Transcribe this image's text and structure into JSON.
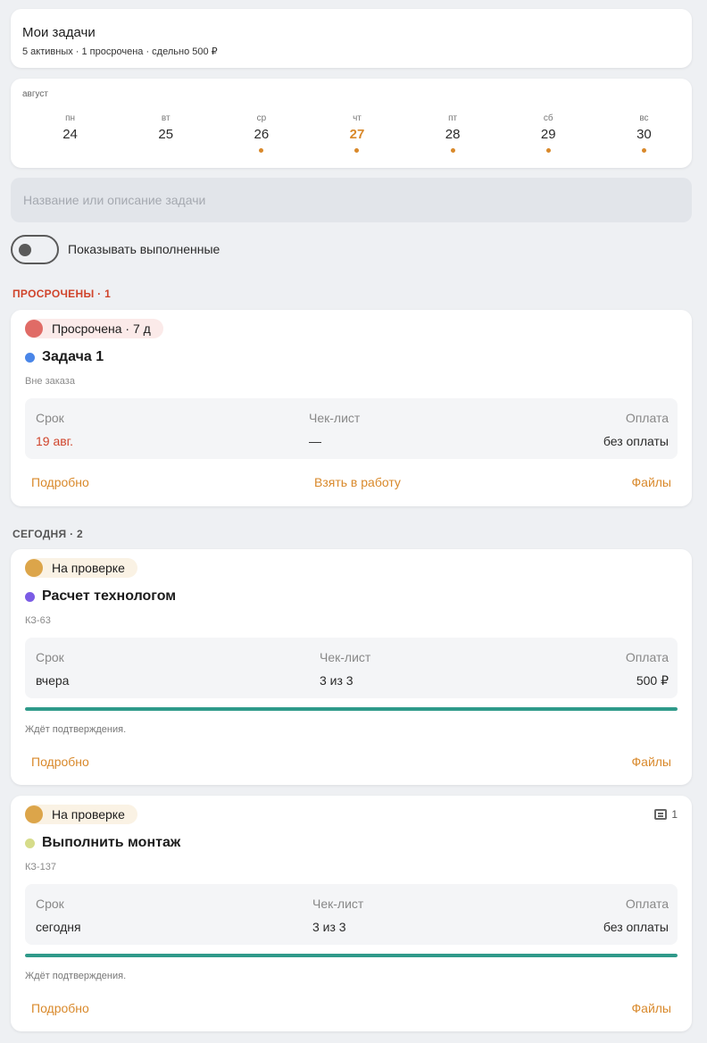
{
  "header": {
    "title": "Мои задачи",
    "subtitle": "5 активных · 1 просрочена · сдельно 500 ₽"
  },
  "calendar": {
    "month": "август",
    "days": [
      {
        "dow": "пн",
        "num": "24",
        "has_tasks": false,
        "today": false
      },
      {
        "dow": "вт",
        "num": "25",
        "has_tasks": false,
        "today": false
      },
      {
        "dow": "ср",
        "num": "26",
        "has_tasks": true,
        "today": false
      },
      {
        "dow": "чт",
        "num": "27",
        "has_tasks": true,
        "today": true
      },
      {
        "dow": "пт",
        "num": "28",
        "has_tasks": true,
        "today": false
      },
      {
        "dow": "сб",
        "num": "29",
        "has_tasks": true,
        "today": false
      },
      {
        "dow": "вс",
        "num": "30",
        "has_tasks": true,
        "today": false
      }
    ],
    "dot_color": "#d9892b"
  },
  "search": {
    "placeholder": "Название или описание задачи",
    "value": ""
  },
  "show_done": {
    "label": "Показывать выполненные",
    "on": false
  },
  "sections": {
    "overdue_title": "ПРОСРОЧЕНЫ · 1",
    "today_title": "СЕГОДНЯ · 2"
  },
  "tasks": [
    {
      "badge": "Просрочена · 7 д",
      "badge_dot_color": "#e06b66",
      "badge_bg": "#fbeae9",
      "title": "Задача 1",
      "title_dot_color": "#4a86e8",
      "subtitle": "Вне заказа",
      "deadline_label": "Срок",
      "deadline_value": "19 авг.",
      "deadline_color": "#d0442b",
      "checklist_label": "Чек-лист",
      "checklist_value": "—",
      "payment_label": "Оплата",
      "payment_value": "без оплаты",
      "actions": {
        "details": "Подробно",
        "take": "Взять в работу",
        "files": "Файлы"
      }
    },
    {
      "badge": "На проверке",
      "badge_dot_color": "#dca54a",
      "badge_bg": "#faf2e4",
      "title": "Расчет технологом",
      "title_dot_color": "#7b5ce5",
      "subtitle": "КЗ-63",
      "deadline_label": "Срок",
      "deadline_value": "вчера",
      "checklist_label": "Чек-лист",
      "checklist_value": "3 из 3",
      "payment_label": "Оплата",
      "payment_value": "500 ₽",
      "progress": 1.0,
      "progress_color": "#2f9a8a",
      "note": "Ждёт подтверждения.",
      "actions": {
        "details": "Подробно",
        "files": "Файлы"
      }
    },
    {
      "badge": "На проверке",
      "badge_dot_color": "#dca54a",
      "badge_bg": "#faf2e4",
      "title": "Выполнить монтаж",
      "title_dot_color": "#d6dc8a",
      "subtitle": "КЗ-137",
      "comments": "1",
      "comment_icon": "comment-icon",
      "deadline_label": "Срок",
      "deadline_value": "сегодня",
      "checklist_label": "Чек-лист",
      "checklist_value": "3 из 3",
      "payment_label": "Оплата",
      "payment_value": "без оплаты",
      "progress": 1.0,
      "progress_color": "#2f9a8a",
      "note": "Ждёт подтверждения.",
      "actions": {
        "details": "Подробно",
        "files": "Файлы"
      }
    }
  ]
}
